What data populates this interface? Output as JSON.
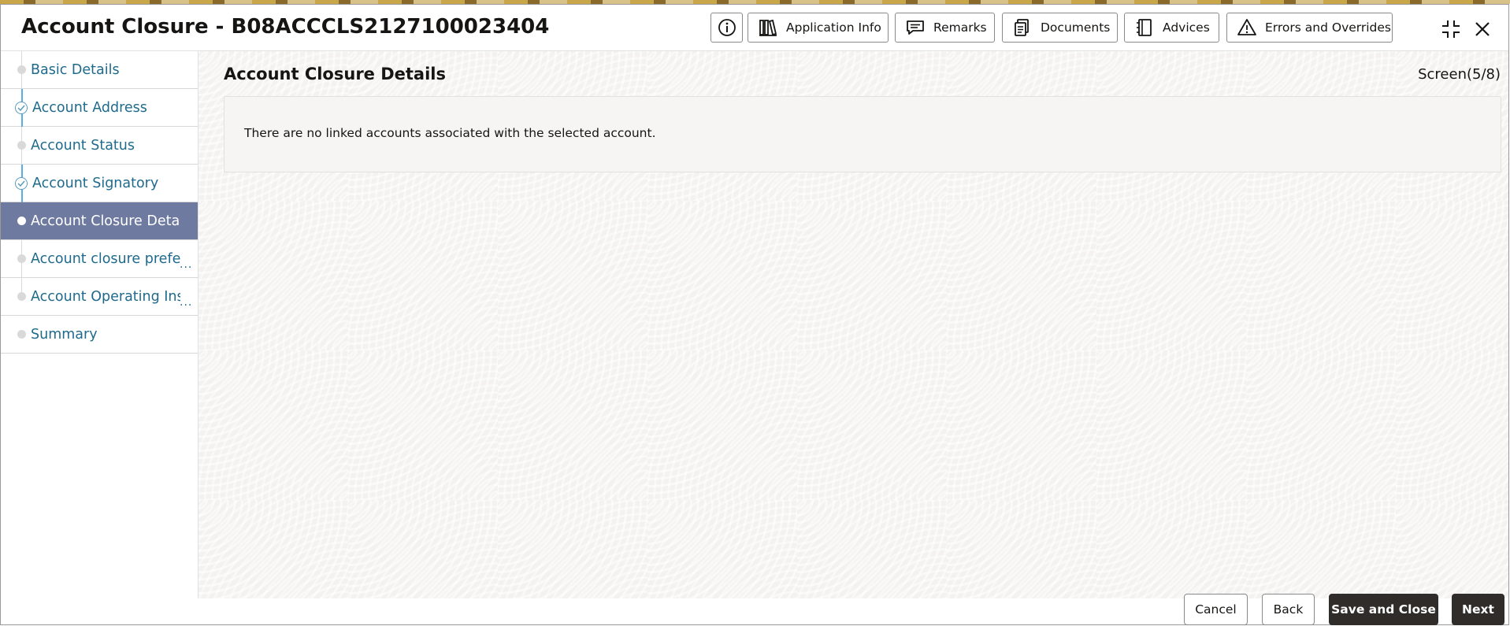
{
  "header": {
    "title": "Account Closure - B08ACCCLS2127100023404",
    "buttons": {
      "application_info": "Application Info",
      "remarks": "Remarks",
      "documents": "Documents",
      "advices": "Advices",
      "errors_overrides": "Errors and Overrides"
    },
    "icons": [
      "info-icon",
      "library-icon",
      "chat-icon",
      "documents-icon",
      "notebook-icon",
      "warning-icon",
      "collapse-icon",
      "close-icon"
    ]
  },
  "sidebar": {
    "items": [
      {
        "label": "Basic Details",
        "state": "pending"
      },
      {
        "label": "Account Address",
        "state": "completed"
      },
      {
        "label": "Account Status",
        "state": "pending"
      },
      {
        "label": "Account Signatory",
        "state": "completed"
      },
      {
        "label": "Account Closure Details",
        "state": "active"
      },
      {
        "label": "Account closure prefere",
        "state": "pending",
        "truncated": true,
        "more": "..."
      },
      {
        "label": "Account Operating Instr",
        "state": "pending",
        "truncated": true,
        "more": "..."
      },
      {
        "label": "Summary",
        "state": "pending"
      }
    ]
  },
  "main": {
    "section_title": "Account Closure Details",
    "screen_indicator": "Screen(5/8)",
    "info_message": "There are no linked accounts associated with the selected account."
  },
  "footer": {
    "cancel": "Cancel",
    "back": "Back",
    "save_and_close": "Save and Close",
    "next": "Next"
  },
  "colors": {
    "active_nav_bg": "#6e7aa0",
    "nav_link": "#1e6a8c",
    "primary_button": "#2f2c2a",
    "completed_marker": "#5aaee0"
  }
}
